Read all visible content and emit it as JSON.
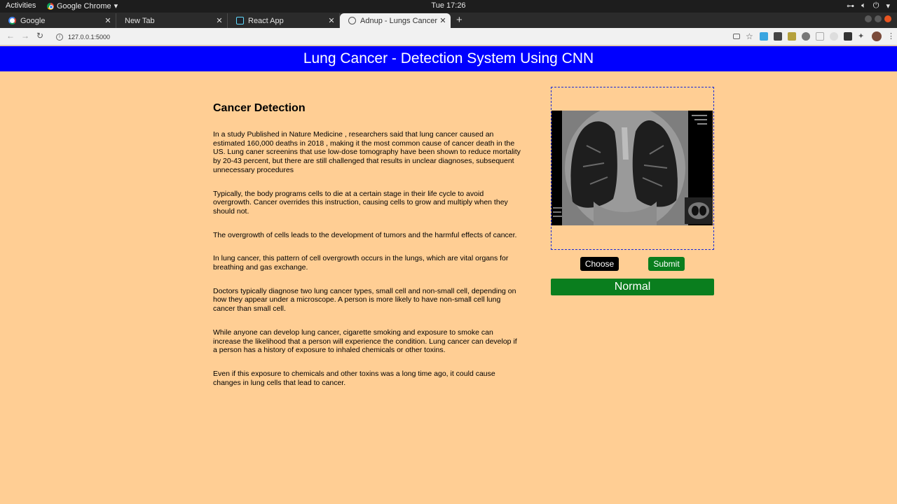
{
  "system_bar": {
    "activities": "Activities",
    "app_name": "Google Chrome",
    "clock": "Tue 17:26"
  },
  "tabs": [
    {
      "label": "Google",
      "icon": "google-icon"
    },
    {
      "label": "New Tab",
      "icon": "none"
    },
    {
      "label": "React App",
      "icon": "react-icon"
    },
    {
      "label": "Adnup - Lungs Cancer Det",
      "icon": "globe-icon"
    }
  ],
  "toolbar": {
    "url": "127.0.0.1:5000"
  },
  "page": {
    "title": "Lung Cancer - Detection System Using CNN",
    "article": {
      "heading": "Cancer Detection",
      "paragraphs": [
        "In a study Published in Nature Medicine , researchers said that lung cancer caused an estimated 160,000 deaths in 2018 , making it the most common cause of cancer death in the US. Lung caner screenins that use low-dose tomography have been shown to reduce mortality by 20-43 percent, but there are still challenged that results in unclear diagnoses, subsequent unnecessary procedures",
        "Typically, the body programs cells to die at a certain stage in their life cycle to avoid overgrowth. Cancer overrides this instruction, causing cells to grow and multiply when they should not.",
        "The overgrowth of cells leads to the development of tumors and the harmful effects of cancer.",
        "In lung cancer, this pattern of cell overgrowth occurs in the lungs, which are vital organs for breathing and gas exchange.",
        "Doctors typically diagnose two lung cancer types, small cell and non-small cell, depending on how they appear under a microscope. A person is more likely to have non-small cell lung cancer than small cell.",
        "While anyone can develop lung cancer, cigarette smoking and exposure to smoke can increase the likelihood that a person will experience the condition. Lung cancer can develop if a person has a history of exposure to inhaled chemicals or other toxins.",
        "Even if this exposure to chemicals and other toxins was a long time ago, it could cause changes in lung cells that lead to cancer."
      ]
    },
    "upload": {
      "choose_label": "Choose",
      "submit_label": "Submit",
      "result": "Normal"
    }
  },
  "colors": {
    "background": "#ffce94",
    "header": "#0000ff",
    "success": "#0a7e1e"
  }
}
